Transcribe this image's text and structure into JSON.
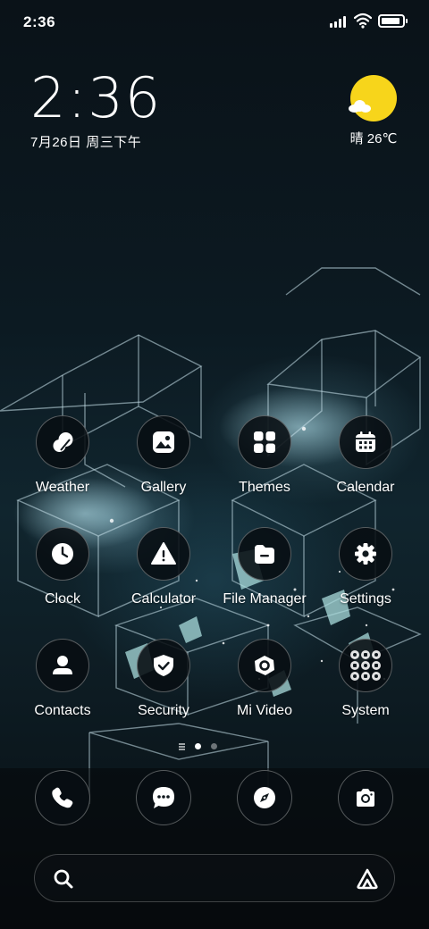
{
  "status_bar": {
    "time": "2:36",
    "icons": [
      "signal-icon",
      "wifi-icon",
      "battery-icon"
    ],
    "battery_level": 0.9
  },
  "clock_widget": {
    "time": "2:36",
    "date": "7月26日 周三下午"
  },
  "weather_widget": {
    "icon": "sunny-with-cloud-icon",
    "text": "晴 26℃",
    "sun_color": "#f7d51b"
  },
  "apps": [
    {
      "label": "Weather",
      "icon": "weather-icon"
    },
    {
      "label": "Gallery",
      "icon": "gallery-icon"
    },
    {
      "label": "Themes",
      "icon": "themes-icon"
    },
    {
      "label": "Calendar",
      "icon": "calendar-icon"
    },
    {
      "label": "Clock",
      "icon": "clock-icon"
    },
    {
      "label": "Calculator",
      "icon": "calculator-icon"
    },
    {
      "label": "File Manager",
      "icon": "file-manager-icon"
    },
    {
      "label": "Settings",
      "icon": "settings-icon"
    },
    {
      "label": "Contacts",
      "icon": "contacts-icon"
    },
    {
      "label": "Security",
      "icon": "security-icon"
    },
    {
      "label": "Mi Video",
      "icon": "mi-video-icon"
    },
    {
      "label": "System",
      "icon": "system-folder-icon"
    }
  ],
  "page_indicator": {
    "pages": 2,
    "current_page": 1
  },
  "dock": [
    {
      "icon": "phone-icon"
    },
    {
      "icon": "messages-icon"
    },
    {
      "icon": "browser-compass-icon"
    },
    {
      "icon": "camera-icon"
    }
  ],
  "search_bar": {
    "icon": "search-icon",
    "assistant_icon": "assistant-icon"
  }
}
